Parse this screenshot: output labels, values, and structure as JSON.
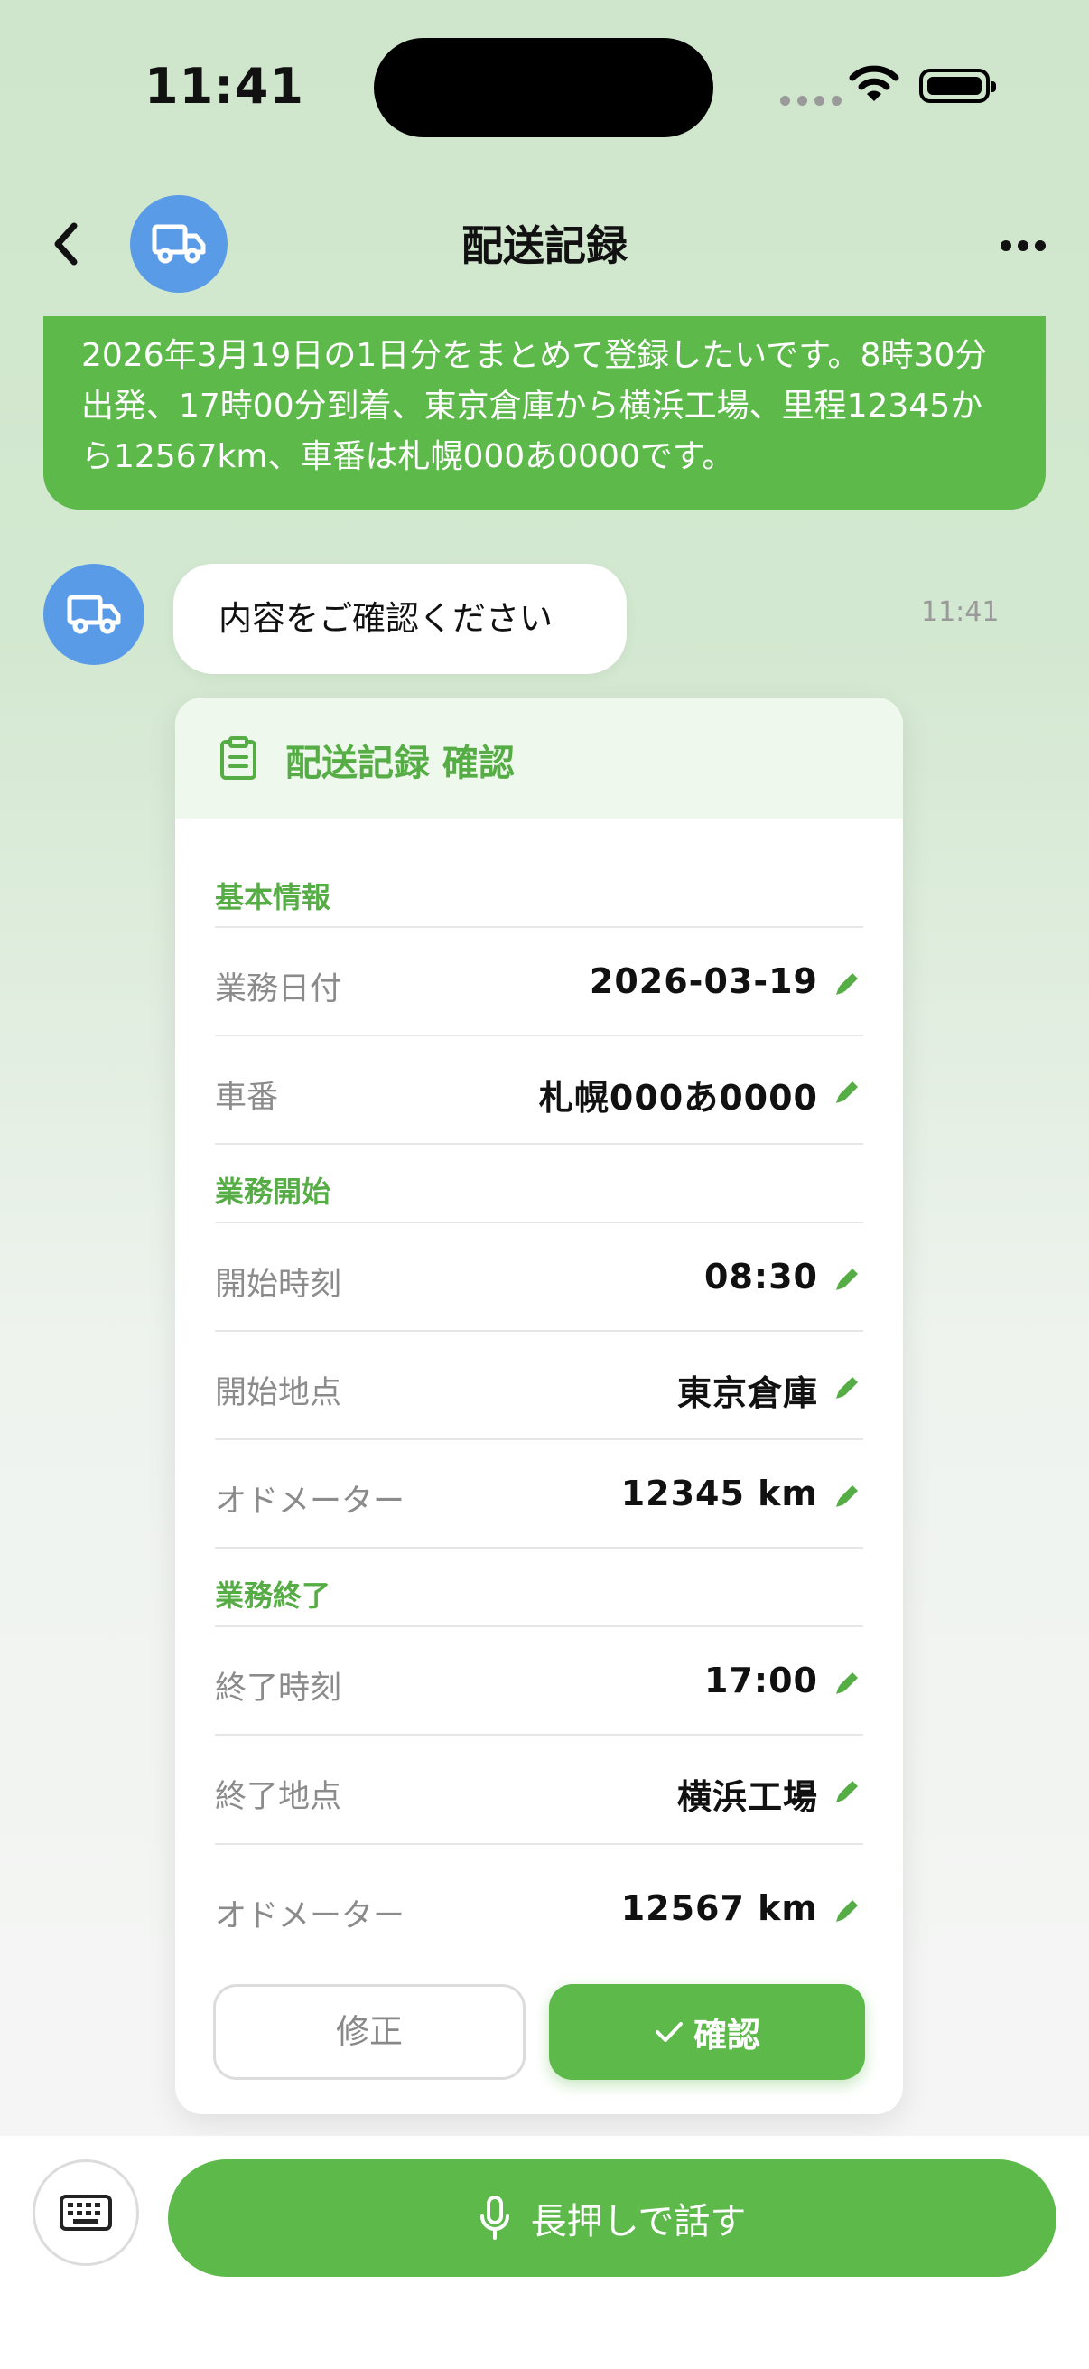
{
  "status_bar": {
    "time": "11:41"
  },
  "header": {
    "title": "配送記録"
  },
  "user_message": {
    "text": "2026年3月19日の1日分をまとめて登録したいです。8時30分出発、17時00分到着、東京倉庫から横浜工場、里程12345から12567km、車番は札幌000あ0000です。"
  },
  "bot_message": {
    "text": "内容をご確認ください",
    "time": "11:41"
  },
  "card": {
    "title": "配送記録 確認",
    "sections": [
      {
        "title": "基本情報",
        "rows": [
          {
            "label": "業務日付",
            "value": "2026-03-19"
          },
          {
            "label": "車番",
            "value": "札幌000あ0000"
          }
        ]
      },
      {
        "title": "業務開始",
        "rows": [
          {
            "label": "開始時刻",
            "value": "08:30"
          },
          {
            "label": "開始地点",
            "value": "東京倉庫"
          },
          {
            "label": "オドメーター",
            "value": "12345 km"
          }
        ]
      },
      {
        "title": "業務終了",
        "rows": [
          {
            "label": "終了時刻",
            "value": "17:00"
          },
          {
            "label": "終了地点",
            "value": "横浜工場"
          },
          {
            "label": "オドメーター",
            "value": "12567 km"
          }
        ]
      }
    ],
    "edit_label": "修正",
    "confirm_label": "確認"
  },
  "input_bar": {
    "talk_label": "長押しで話す"
  },
  "colors": {
    "accent": "#5cb94a",
    "avatar": "#5a9be8"
  },
  "icons": [
    "back-icon",
    "truck-icon",
    "more-icon",
    "clipboard-icon",
    "pencil-icon",
    "check-icon",
    "keyboard-icon",
    "microphone-icon",
    "wifi-icon",
    "battery-icon"
  ]
}
